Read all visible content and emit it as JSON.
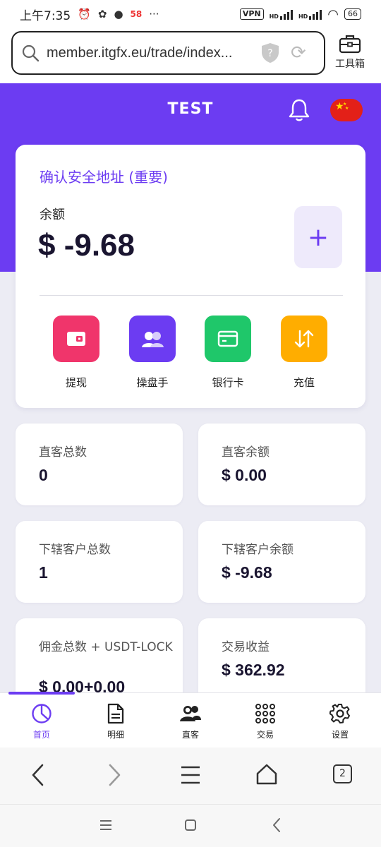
{
  "status_bar": {
    "time": "上午7:35",
    "extra_text": "58",
    "dots": "···",
    "vpn": "VPN",
    "hd": "HD",
    "battery": "66"
  },
  "browser": {
    "url": "member.itgfx.eu/trade/index...",
    "toolbox_label": "工具箱",
    "tabs_count": "2"
  },
  "header": {
    "title": "TEST"
  },
  "balance_card": {
    "confirm_link": "确认安全地址 (重要)",
    "balance_label": "余额",
    "balance_value": "$ -9.68",
    "add_label": "+"
  },
  "actions": [
    {
      "label": "提现",
      "color": "#f0356b"
    },
    {
      "label": "操盘手",
      "color": "#6c3cf2"
    },
    {
      "label": "银行卡",
      "color": "#1fc76a"
    },
    {
      "label": "充值",
      "color": "#ffad00"
    }
  ],
  "stats": [
    {
      "label": "直客总数",
      "value": "0"
    },
    {
      "label": "直客余额",
      "value": "$ 0.00"
    },
    {
      "label": "下辖客户总数",
      "value": "1"
    },
    {
      "label": "下辖客户余额",
      "value": "$ -9.68"
    },
    {
      "label": "佣金总数 + USDT-LOCK",
      "value": "$ 0.00+0.00"
    },
    {
      "label": "交易收益",
      "value": "$ 362.92"
    }
  ],
  "bottom_nav": [
    {
      "label": "首页",
      "icon": "pie-chart-icon",
      "active": true
    },
    {
      "label": "明细",
      "icon": "document-icon",
      "active": false
    },
    {
      "label": "直客",
      "icon": "users-icon",
      "active": false
    },
    {
      "label": "交易",
      "icon": "grid-dots-icon",
      "active": false
    },
    {
      "label": "设置",
      "icon": "gear-icon",
      "active": false
    }
  ],
  "colors": {
    "primary": "#6c3cf2",
    "background": "#ececf4"
  }
}
